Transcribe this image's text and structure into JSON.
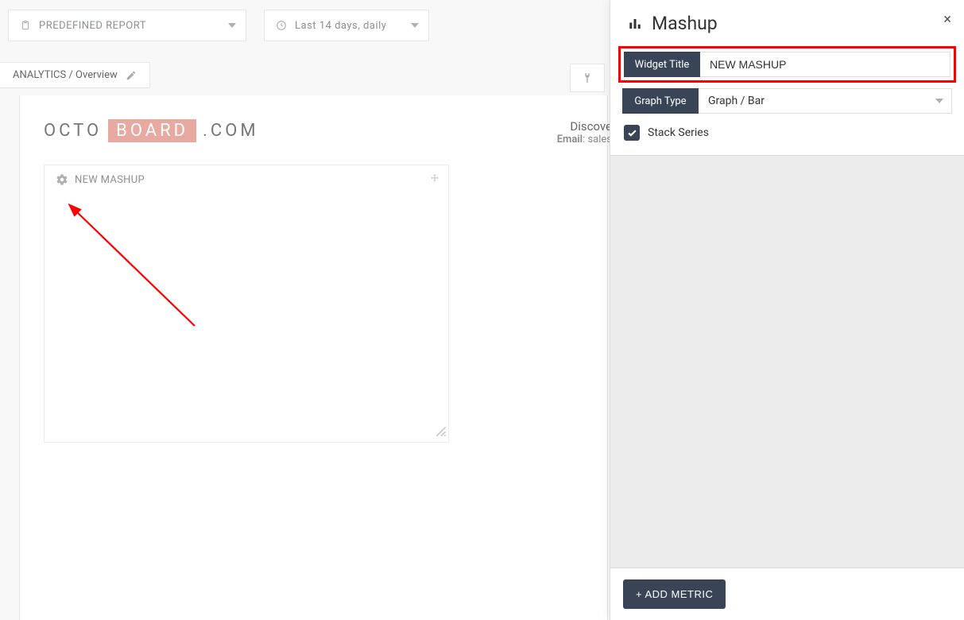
{
  "toolbar": {
    "report_label": "PREDEFINED REPORT",
    "date_label": "Last 14 days, daily"
  },
  "breadcrumb": {
    "text": "ANALYTICS / Overview"
  },
  "logo": {
    "p1": "OCTO",
    "p2": "BOARD",
    "p3": ".COM"
  },
  "discover": {
    "title": "Discove",
    "email_label": "Email",
    "email_sep": ": ",
    "email_value": "sales"
  },
  "widget": {
    "title": "NEW MASHUP"
  },
  "panel": {
    "title": "Mashup",
    "widget_title_label": "Widget Title",
    "widget_title_value": "NEW MASHUP",
    "graph_type_label": "Graph Type",
    "graph_type_value": "Graph / Bar",
    "stack_label": "Stack Series",
    "add_metric": "+ ADD METRIC"
  }
}
